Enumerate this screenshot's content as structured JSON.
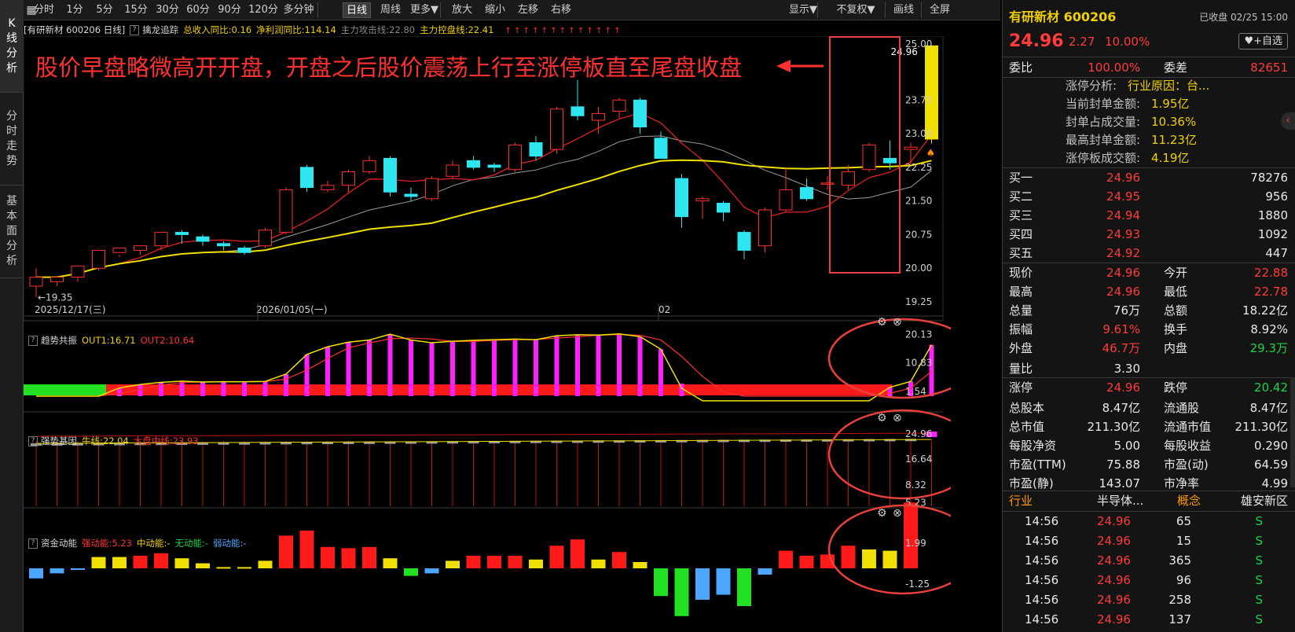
{
  "sidebar": {
    "tabs": [
      {
        "label": "K线分析",
        "chars": [
          "K",
          "线",
          "分",
          "析"
        ],
        "active": true
      },
      {
        "label": "分时走势",
        "chars": [
          "分",
          "时",
          "走",
          "势"
        ],
        "active": false
      },
      {
        "label": "基本面分析",
        "chars": [
          "基",
          "本",
          "面",
          "分",
          "析"
        ],
        "active": false
      }
    ]
  },
  "toolbar": {
    "buttons": [
      {
        "label": "分时"
      },
      {
        "label": "1分"
      },
      {
        "label": "5分"
      },
      {
        "label": "15分"
      },
      {
        "label": "30分"
      },
      {
        "label": "60分"
      },
      {
        "label": "90分"
      },
      {
        "label": "120分"
      },
      {
        "label": "多分钟"
      },
      {
        "label": "日线",
        "active": true
      },
      {
        "label": "周线"
      },
      {
        "label": "更多▼"
      },
      {
        "label": "放大"
      },
      {
        "label": "缩小"
      },
      {
        "label": "左移"
      },
      {
        "label": "右移"
      },
      {
        "label": "显示▼"
      },
      {
        "label": "不复权▼"
      },
      {
        "label": "画线"
      },
      {
        "label": "全屏"
      }
    ]
  },
  "main_chart": {
    "title": "[有研新材 600206 日线]",
    "indicator_name": "擒龙追踪",
    "indicators": [
      {
        "label": "总收入同比:0.16",
        "color": "#f0d000"
      },
      {
        "label": "净利润同比:114.14",
        "color": "#f0d000"
      },
      {
        "label": "主力攻击线:22.80",
        "color": "#888888"
      },
      {
        "label": "主力控盘线:22.41",
        "color": "#f0d000"
      }
    ],
    "signal_marks": "↑ ↑ ↑ ↑ ↑ ↑ ↑ ↑ ↑ ↑ ↑ ↑ ↑",
    "annotation": "股价早盘略微高开开盘，开盘之后股价震荡上行至涨停板直至尾盘收盘",
    "price_label": "24.96",
    "low_label": "19.35",
    "y_ticks": [
      "25.00",
      "23.75",
      "23.00",
      "22.25",
      "21.50",
      "20.75",
      "20.00",
      "19.25"
    ],
    "dates": [
      "2025/12/17(三)",
      "2026/01/05(一)",
      "02"
    ]
  },
  "chart_data": [
    {
      "type": "candlestick",
      "title": "有研新材 600206 日线",
      "ohlc": [
        [
          19.6,
          19.8,
          19.35,
          20.0
        ],
        [
          19.7,
          19.8,
          19.6,
          19.7
        ],
        [
          19.8,
          20.05,
          19.7,
          20.0
        ],
        [
          20.0,
          20.4,
          19.95,
          20.4
        ],
        [
          20.35,
          20.45,
          20.25,
          20.3
        ],
        [
          20.4,
          20.5,
          20.3,
          20.45
        ],
        [
          20.5,
          20.8,
          20.4,
          20.75
        ],
        [
          20.8,
          20.75,
          20.55,
          20.85
        ],
        [
          20.7,
          20.6,
          20.5,
          20.75
        ],
        [
          20.55,
          20.5,
          20.4,
          20.6
        ],
        [
          20.45,
          20.35,
          20.3,
          20.5
        ],
        [
          20.5,
          20.85,
          20.45,
          20.9
        ],
        [
          20.8,
          21.75,
          20.75,
          21.8
        ],
        [
          22.25,
          21.8,
          21.7,
          22.3
        ],
        [
          21.75,
          21.85,
          21.7,
          21.95
        ],
        [
          21.85,
          22.15,
          21.7,
          22.2
        ],
        [
          22.15,
          22.4,
          22.1,
          22.5
        ],
        [
          22.45,
          21.7,
          21.6,
          22.5
        ],
        [
          21.65,
          21.6,
          21.5,
          21.8
        ],
        [
          21.55,
          22.0,
          21.5,
          22.05
        ],
        [
          22.05,
          22.3,
          22.0,
          22.4
        ],
        [
          22.4,
          22.25,
          22.2,
          22.5
        ],
        [
          22.3,
          22.25,
          22.15,
          22.35
        ],
        [
          22.2,
          22.75,
          22.15,
          22.8
        ],
        [
          22.8,
          22.5,
          22.4,
          22.95
        ],
        [
          22.65,
          23.55,
          22.55,
          23.6
        ],
        [
          23.6,
          23.4,
          23.3,
          24.2
        ],
        [
          23.3,
          23.45,
          23.0,
          23.6
        ],
        [
          23.5,
          23.75,
          23.35,
          23.8
        ],
        [
          23.75,
          23.15,
          23.0,
          23.8
        ],
        [
          22.9,
          22.45,
          22.45,
          23.05
        ],
        [
          22.0,
          21.15,
          20.9,
          22.1
        ],
        [
          21.5,
          21.55,
          21.1,
          21.6
        ],
        [
          21.45,
          21.25,
          21.05,
          21.5
        ],
        [
          20.8,
          20.4,
          20.2,
          20.85
        ],
        [
          20.5,
          21.3,
          20.35,
          21.35
        ],
        [
          21.3,
          21.75,
          21.25,
          22.25
        ],
        [
          21.8,
          21.55,
          21.5,
          22.0
        ],
        [
          21.9,
          21.9,
          21.75,
          22.05
        ],
        [
          21.85,
          22.15,
          21.75,
          22.3
        ],
        [
          22.2,
          22.75,
          22.15,
          22.8
        ],
        [
          22.45,
          22.35,
          22.2,
          22.85
        ],
        [
          22.65,
          22.7,
          22.3,
          22.8
        ],
        [
          22.88,
          24.96,
          22.78,
          24.96
        ]
      ],
      "ma_attack_end": 22.8,
      "ma_control_end": 22.41,
      "ylim": [
        19.25,
        25.0
      ]
    },
    {
      "type": "bar",
      "title": "趋势共振",
      "series": [
        {
          "name": "OUT1",
          "last": 16.71
        },
        {
          "name": "OUT2",
          "last": 10.64
        }
      ],
      "values": [
        0,
        0,
        0,
        0,
        2.7,
        3.8,
        4.5,
        4.9,
        4.6,
        4.7,
        4.7,
        4.8,
        7.2,
        13.6,
        16.1,
        17.6,
        18.3,
        20.2,
        18.3,
        17.4,
        17.9,
        18.2,
        18.4,
        18.6,
        18.4,
        19.7,
        20.0,
        19.9,
        20.3,
        19.4,
        15.3,
        4.1,
        0,
        0,
        0,
        0,
        0,
        0,
        0,
        0,
        0,
        2.9,
        4.8,
        16.71
      ],
      "y_ticks": [
        "20.13",
        "10.83",
        "1.54"
      ]
    },
    {
      "type": "bar",
      "title": "强势基因",
      "series": [
        {
          "name": "牛线",
          "last": 22.04
        },
        {
          "name": "大盘中线",
          "last": 23.93
        }
      ],
      "y_ticks": [
        "24.96",
        "16.64",
        "8.32"
      ]
    },
    {
      "type": "bar",
      "title": "资金动能",
      "series": [
        {
          "name": "强动能",
          "last": 5.23
        },
        {
          "name": "中动能",
          "last": null
        },
        {
          "name": "无动能",
          "last": null
        },
        {
          "name": "弱动能",
          "last": null
        }
      ],
      "values": [
        -0.8,
        -0.4,
        -0.1,
        0.9,
        0.9,
        1.0,
        1.2,
        0.8,
        0.4,
        0.1,
        0.1,
        0.6,
        2.6,
        3.0,
        1.7,
        1.6,
        1.7,
        0.8,
        -0.6,
        -0.4,
        0.6,
        1.0,
        1.0,
        1.0,
        0.7,
        1.8,
        2.3,
        0.7,
        1.3,
        0.5,
        -2.2,
        -3.8,
        -2.5,
        -2.1,
        -3.0,
        -0.5,
        1.4,
        1.0,
        1.1,
        1.8,
        1.5,
        1.4,
        5.23
      ],
      "y_ticks": [
        "5.23",
        "1.99",
        "-1.25"
      ]
    }
  ],
  "panels": {
    "p1": {
      "name": "趋势共振",
      "items": [
        {
          "label": "OUT1:16.71",
          "color": "#f0d000"
        },
        {
          "label": "OUT2:10.64",
          "color": "#ff3030"
        }
      ]
    },
    "p2": {
      "name": "强势基因",
      "items": [
        {
          "label": "牛线:22.04",
          "color": "#f0d000"
        },
        {
          "label": "大盘中线:23.93",
          "color": "#ff3030"
        }
      ]
    },
    "p3": {
      "name": "资金动能",
      "items": [
        {
          "label": "强动能:5.23",
          "color": "#ff3030"
        },
        {
          "label": "中动能:-",
          "color": "#f0d000"
        },
        {
          "label": "无动能:-",
          "color": "#1fd14a"
        },
        {
          "label": "弱动能:-",
          "color": "#4da6ff"
        }
      ]
    }
  },
  "quote": {
    "name": "有研新材 600206",
    "status": "已收盘 02/25 15:00",
    "watch": "♥+自选",
    "price": "24.96",
    "change": "2.27",
    "pct": "10.00%",
    "weibi_label": "委比",
    "weibi": "100.00%",
    "weicha_label": "委差",
    "weicha": "82651",
    "limit": [
      {
        "label": "涨停分析:",
        "value": "行业原因：台..."
      },
      {
        "label": "当前封单金额:",
        "value": "1.95亿"
      },
      {
        "label": "封单占成交量:",
        "value": "10.36%"
      },
      {
        "label": "最高封单金额:",
        "value": "11.23亿"
      },
      {
        "label": "涨停板成交额:",
        "value": "4.19亿"
      }
    ],
    "bids": [
      {
        "label": "买一",
        "price": "24.96",
        "vol": "78276"
      },
      {
        "label": "买二",
        "price": "24.95",
        "vol": "956"
      },
      {
        "label": "买三",
        "price": "24.94",
        "vol": "1880"
      },
      {
        "label": "买四",
        "price": "24.93",
        "vol": "1092"
      },
      {
        "label": "买五",
        "price": "24.92",
        "vol": "447"
      }
    ],
    "stats": [
      [
        {
          "l": "现价",
          "v": "24.96",
          "c": "red"
        },
        {
          "l": "今开",
          "v": "22.88",
          "c": "red"
        }
      ],
      [
        {
          "l": "最高",
          "v": "24.96",
          "c": "red"
        },
        {
          "l": "最低",
          "v": "22.78",
          "c": "red"
        }
      ],
      [
        {
          "l": "总量",
          "v": "76万",
          "c": "white"
        },
        {
          "l": "总额",
          "v": "18.22亿",
          "c": "white"
        }
      ],
      [
        {
          "l": "振幅",
          "v": "9.61%",
          "c": "red"
        },
        {
          "l": "换手",
          "v": "8.92%",
          "c": "white"
        }
      ],
      [
        {
          "l": "外盘",
          "v": "46.7万",
          "c": "red"
        },
        {
          "l": "内盘",
          "v": "29.3万",
          "c": "green"
        }
      ],
      [
        {
          "l": "量比",
          "v": "3.30",
          "c": "white"
        },
        {
          "l": "",
          "v": "",
          "c": "white"
        }
      ],
      [
        {
          "l": "涨停",
          "v": "24.96",
          "c": "red"
        },
        {
          "l": "跌停",
          "v": "20.42",
          "c": "green"
        }
      ],
      [
        {
          "l": "总股本",
          "v": "8.47亿",
          "c": "white"
        },
        {
          "l": "流通股",
          "v": "8.47亿",
          "c": "white"
        }
      ],
      [
        {
          "l": "总市值",
          "v": "211.30亿",
          "c": "white"
        },
        {
          "l": "流通市值",
          "v": "211.30亿",
          "c": "white"
        }
      ],
      [
        {
          "l": "每股净资",
          "v": "5.00",
          "c": "white"
        },
        {
          "l": "每股收益",
          "v": "0.290",
          "c": "white"
        }
      ],
      [
        {
          "l": "市盈(TTM)",
          "v": "75.88",
          "c": "white"
        },
        {
          "l": "市盈(动)",
          "v": "64.59",
          "c": "white"
        }
      ],
      [
        {
          "l": "市盈(静)",
          "v": "143.07",
          "c": "white"
        },
        {
          "l": "市净率",
          "v": "4.99",
          "c": "white"
        }
      ]
    ],
    "industry": {
      "l1": "行业",
      "v1": "半导体...",
      "l2": "概念",
      "v2": "雄安新区"
    },
    "trades": [
      {
        "time": "14:56",
        "price": "24.96",
        "vol": "65",
        "side": "S"
      },
      {
        "time": "14:56",
        "price": "24.96",
        "vol": "15",
        "side": "S"
      },
      {
        "time": "14:56",
        "price": "24.96",
        "vol": "365",
        "side": "S"
      },
      {
        "time": "14:56",
        "price": "24.96",
        "vol": "96",
        "side": "S"
      },
      {
        "time": "14:56",
        "price": "24.96",
        "vol": "258",
        "side": "S"
      },
      {
        "time": "14:56",
        "price": "24.96",
        "vol": "137",
        "side": "S"
      }
    ]
  }
}
